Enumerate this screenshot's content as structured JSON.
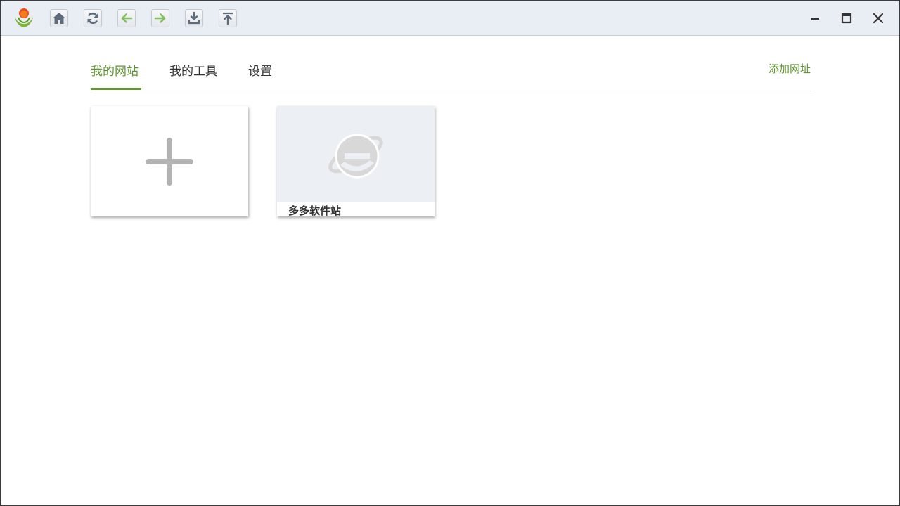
{
  "toolbar": {
    "buttons": [
      {
        "name": "home-button",
        "icon": "home-icon"
      },
      {
        "name": "refresh-button",
        "icon": "refresh-icon"
      },
      {
        "name": "back-button",
        "icon": "arrow-left-icon"
      },
      {
        "name": "forward-button",
        "icon": "arrow-right-icon"
      },
      {
        "name": "download-button",
        "icon": "download-icon"
      },
      {
        "name": "upload-button",
        "icon": "upload-icon"
      }
    ],
    "window_controls": [
      "minimize-icon",
      "maximize-icon",
      "close-icon"
    ]
  },
  "tabs": {
    "items": [
      {
        "label": "我的网站",
        "active": true
      },
      {
        "label": "我的工具",
        "active": false
      },
      {
        "label": "设置",
        "active": false
      }
    ],
    "add_url_label": "添加网址"
  },
  "cards": {
    "add_card_icon": "plus-icon",
    "sites": [
      {
        "name": "多多软件站",
        "icon": "ie-logo-icon"
      }
    ]
  },
  "colors": {
    "accent": "#5f9630",
    "titlebar_bg": "#e9edf4",
    "thumb_bg": "#eceff3"
  }
}
